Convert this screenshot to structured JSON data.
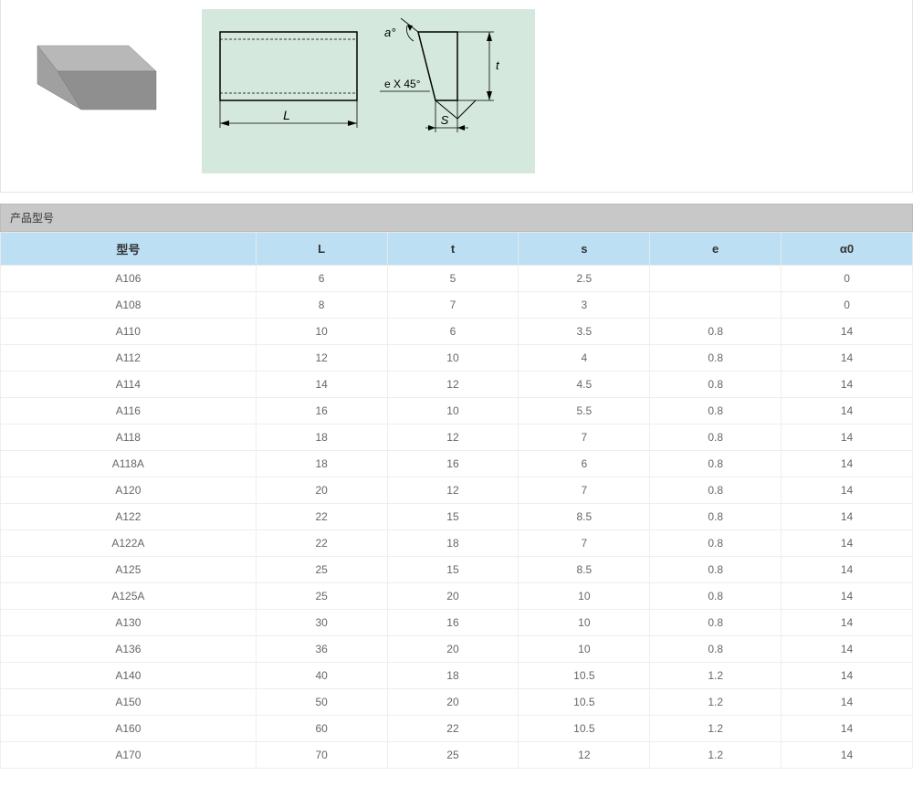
{
  "diagram": {
    "angle_label": "a°",
    "chamfer_label": "e X 45°",
    "dim_L": "L",
    "dim_t": "t",
    "dim_S": "S"
  },
  "section_title": "产品型号",
  "columns": [
    "型号",
    "L",
    "t",
    "s",
    "e",
    "α0"
  ],
  "rows": [
    {
      "model": "A106",
      "L": "6",
      "t": "5",
      "s": "2.5",
      "e": "",
      "a0": "0"
    },
    {
      "model": "A108",
      "L": "8",
      "t": "7",
      "s": "3",
      "e": "",
      "a0": "0"
    },
    {
      "model": "A110",
      "L": "10",
      "t": "6",
      "s": "3.5",
      "e": "0.8",
      "a0": "14"
    },
    {
      "model": "A112",
      "L": "12",
      "t": "10",
      "s": "4",
      "e": "0.8",
      "a0": "14"
    },
    {
      "model": "A114",
      "L": "14",
      "t": "12",
      "s": "4.5",
      "e": "0.8",
      "a0": "14"
    },
    {
      "model": "A116",
      "L": "16",
      "t": "10",
      "s": "5.5",
      "e": "0.8",
      "a0": "14"
    },
    {
      "model": "A118",
      "L": "18",
      "t": "12",
      "s": "7",
      "e": "0.8",
      "a0": "14"
    },
    {
      "model": "A118A",
      "L": "18",
      "t": "16",
      "s": "6",
      "e": "0.8",
      "a0": "14"
    },
    {
      "model": "A120",
      "L": "20",
      "t": "12",
      "s": "7",
      "e": "0.8",
      "a0": "14"
    },
    {
      "model": "A122",
      "L": "22",
      "t": "15",
      "s": "8.5",
      "e": "0.8",
      "a0": "14"
    },
    {
      "model": "A122A",
      "L": "22",
      "t": "18",
      "s": "7",
      "e": "0.8",
      "a0": "14"
    },
    {
      "model": "A125",
      "L": "25",
      "t": "15",
      "s": "8.5",
      "e": "0.8",
      "a0": "14"
    },
    {
      "model": "A125A",
      "L": "25",
      "t": "20",
      "s": "10",
      "e": "0.8",
      "a0": "14"
    },
    {
      "model": "A130",
      "L": "30",
      "t": "16",
      "s": "10",
      "e": "0.8",
      "a0": "14"
    },
    {
      "model": "A136",
      "L": "36",
      "t": "20",
      "s": "10",
      "e": "0.8",
      "a0": "14"
    },
    {
      "model": "A140",
      "L": "40",
      "t": "18",
      "s": "10.5",
      "e": "1.2",
      "a0": "14"
    },
    {
      "model": "A150",
      "L": "50",
      "t": "20",
      "s": "10.5",
      "e": "1.2",
      "a0": "14"
    },
    {
      "model": "A160",
      "L": "60",
      "t": "22",
      "s": "10.5",
      "e": "1.2",
      "a0": "14"
    },
    {
      "model": "A170",
      "L": "70",
      "t": "25",
      "s": "12",
      "e": "1.2",
      "a0": "14"
    }
  ]
}
